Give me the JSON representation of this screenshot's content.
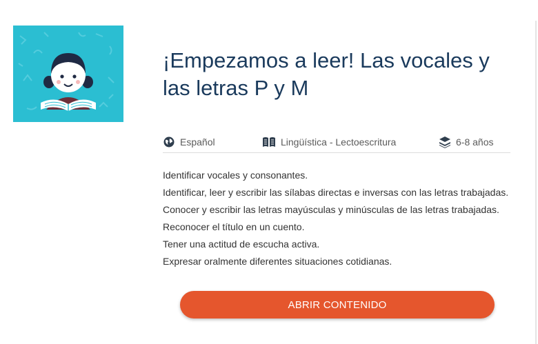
{
  "resource": {
    "title": "¡Empezamos a leer! Las vocales y las letras P y M",
    "language": "Español",
    "subject": "Lingüística - Lectoescritura",
    "age_range": "6-8 años",
    "language_icon": "globe-icon",
    "subject_icon": "open-book-icon",
    "age_icon": "layers-icon",
    "objectives": [
      "Identificar vocales y consonantes.",
      "Identificar, leer y escribir las sílabas directas e inversas con las letras trabajadas.",
      "Conocer y escribir las letras mayúsculas y minúsculas de las letras trabajadas.",
      "Reconocer el título en un cuento.",
      "Tener una actitud de escucha activa.",
      "Expresar oralmente diferentes situaciones cotidianas."
    ],
    "open_button_label": "ABRIR CONTENIDO"
  },
  "colors": {
    "cover_background": "#2bbed2",
    "title_text": "#1a3a5c",
    "button": "#e5562d"
  }
}
